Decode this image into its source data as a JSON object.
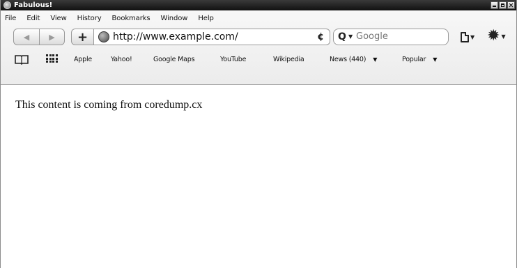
{
  "window": {
    "title": "Fabulous!"
  },
  "menu": [
    "File",
    "Edit",
    "View",
    "History",
    "Bookmarks",
    "Window",
    "Help"
  ],
  "navbar": {
    "back_icon": "◀",
    "forward_icon": "▶",
    "add_icon": "+",
    "url": "http://www.example.com/",
    "reload_icon": "¢",
    "search_placeholder": "Google"
  },
  "bookmarks": {
    "items": [
      "Apple",
      "Yahoo!",
      "Google Maps",
      "YouTube",
      "Wikipedia"
    ],
    "folders": [
      "News (440)",
      "Popular"
    ]
  },
  "content": {
    "text": "This content is coming from coredump.cx"
  }
}
